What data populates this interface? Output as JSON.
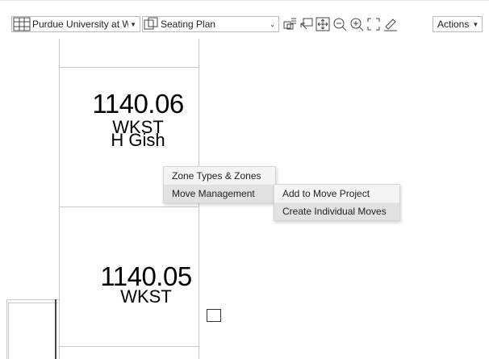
{
  "toolbar": {
    "site_select": "Purdue University at West Lafayette",
    "view_select": "Seating Plan",
    "actions_label": "Actions",
    "icons": [
      "layers-icon",
      "select-area-icon",
      "pan-icon",
      "zoom-out-icon",
      "zoom-in-icon",
      "fullscreen-icon",
      "measure-icon"
    ]
  },
  "rooms": [
    {
      "number": "1140.06",
      "code": "WKST",
      "occupant": "H Gish"
    },
    {
      "number": "1140.05",
      "code": "WKST",
      "occupant": ""
    }
  ],
  "context_menu": {
    "items": [
      "Zone Types & Zones",
      "Move Management"
    ]
  },
  "submenu": {
    "items": [
      "Add to Move Project",
      "Create Individual Moves"
    ]
  }
}
